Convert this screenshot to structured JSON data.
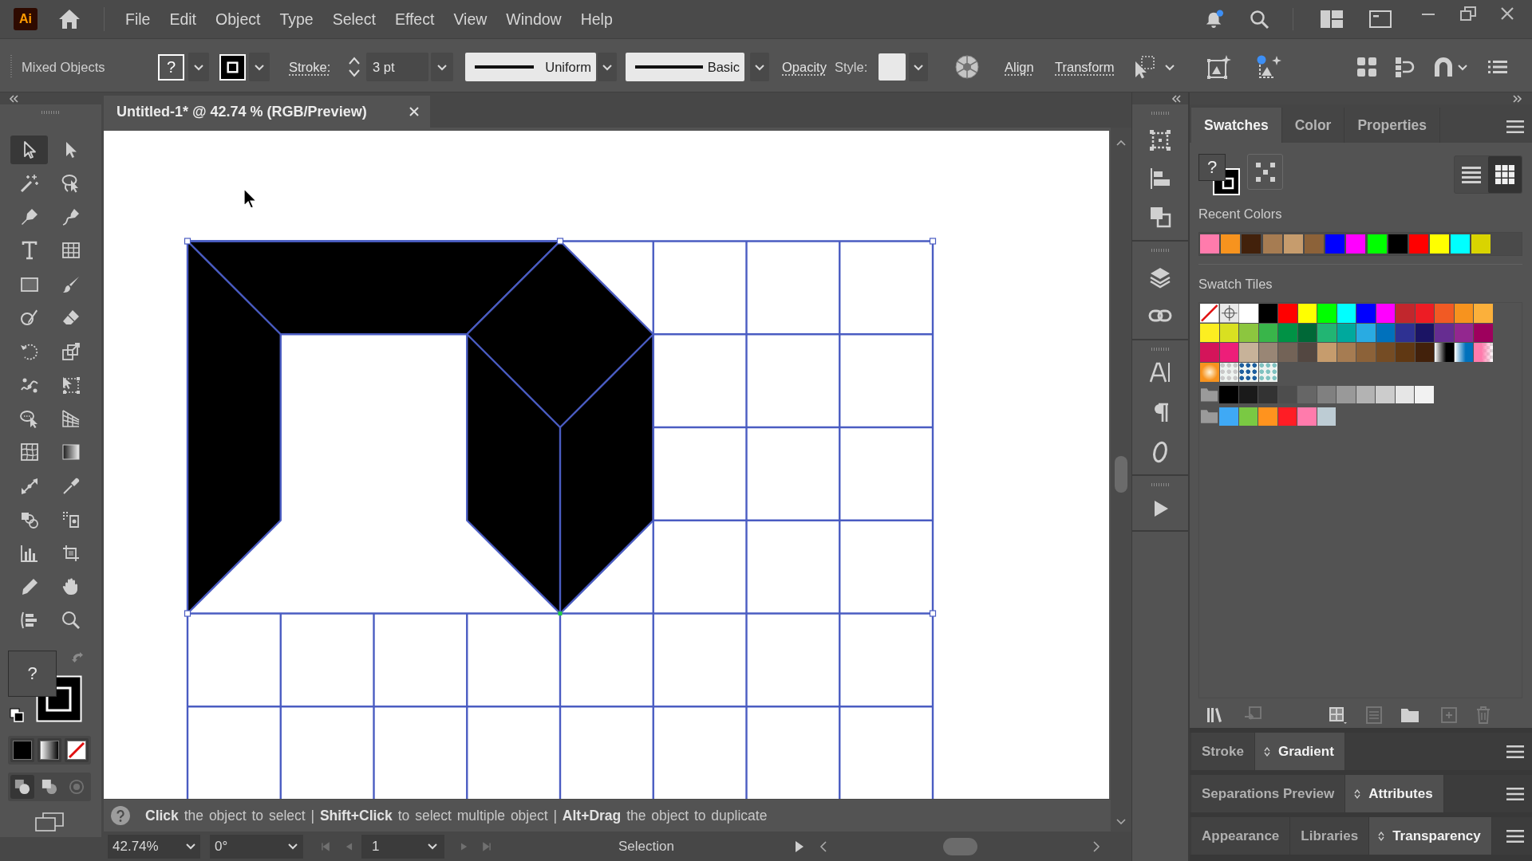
{
  "menu_bar": {
    "logo": "Ai",
    "items": [
      "File",
      "Edit",
      "Object",
      "Type",
      "Select",
      "Effect",
      "View",
      "Window",
      "Help"
    ]
  },
  "control_bar": {
    "selection": "Mixed Objects",
    "fill": "?",
    "stroke_label": "Stroke:",
    "stroke_weight": "3 pt",
    "profile": "Uniform",
    "brush": "Basic",
    "opacity": "Opacity",
    "style_label": "Style:",
    "align": "Align",
    "transform": "Transform"
  },
  "toolbar": {
    "tools": [
      {
        "kind": "selection",
        "selected": true
      },
      {
        "kind": "direct-selection",
        "selected": false
      },
      {
        "kind": "magic-wand",
        "selected": false
      },
      {
        "kind": "lasso",
        "selected": false
      },
      {
        "kind": "pen",
        "selected": false
      },
      {
        "kind": "curvature",
        "selected": false
      },
      {
        "kind": "type",
        "selected": false
      },
      {
        "kind": "grid",
        "selected": false
      },
      {
        "kind": "rectangle",
        "selected": false
      },
      {
        "kind": "paintbrush",
        "selected": false
      },
      {
        "kind": "shaper",
        "selected": false
      },
      {
        "kind": "eraser",
        "selected": false
      },
      {
        "kind": "rotate",
        "selected": false
      },
      {
        "kind": "scale",
        "selected": false
      },
      {
        "kind": "puppet-warp",
        "selected": false
      },
      {
        "kind": "free-transform",
        "selected": false
      },
      {
        "kind": "shape-builder",
        "selected": false
      },
      {
        "kind": "perspective-grid",
        "selected": false
      },
      {
        "kind": "mesh",
        "selected": false
      },
      {
        "kind": "gradient",
        "selected": false
      },
      {
        "kind": "width",
        "selected": false
      },
      {
        "kind": "eyedropper",
        "selected": false
      },
      {
        "kind": "blend",
        "selected": false
      },
      {
        "kind": "live-paint-bucket",
        "selected": false
      },
      {
        "kind": "column-graph",
        "selected": false
      },
      {
        "kind": "artboard",
        "selected": false
      },
      {
        "kind": "pencil",
        "selected": false
      },
      {
        "kind": "hand",
        "selected": false
      },
      {
        "kind": "intertwine",
        "selected": false
      },
      {
        "kind": "zoom",
        "selected": false
      }
    ],
    "fill": "?",
    "color_modes": [
      {
        "kind": "color"
      },
      {
        "kind": "gradient"
      },
      {
        "kind": "none"
      }
    ],
    "draw_modes": [
      {
        "kind": "normal",
        "selected": true,
        "disabled": false
      },
      {
        "kind": "behind",
        "selected": false,
        "disabled": false
      },
      {
        "kind": "inside",
        "selected": false,
        "disabled": true
      }
    ]
  },
  "document": {
    "tab": "Untitled-1* @ 42.74 % (RGB/Preview)",
    "hint": "**Click** the object to select | **Shift+Click** to select multiple object | **Alt+Drag** the object to duplicate"
  },
  "status_bar": {
    "zoom": "42.74%",
    "rotation": "0°",
    "nav": [
      {
        "kind": "first",
        "disabled": true
      },
      {
        "kind": "previous",
        "disabled": true
      },
      {
        "kind": "next",
        "disabled": true
      },
      {
        "kind": "last",
        "disabled": true
      }
    ],
    "artboard": "1",
    "tool": "Selection"
  },
  "panels": {
    "tabs": [
      {
        "label": "Swatches",
        "selected": true
      },
      {
        "label": "Color",
        "selected": false
      },
      {
        "label": "Properties",
        "selected": false
      }
    ],
    "fill": "?",
    "views": [
      {
        "kind": "list",
        "selected": false
      },
      {
        "kind": "grid",
        "selected": true
      }
    ],
    "recent_label": "Recent Colors",
    "recent_colors": [
      {
        "color": "#ff7bac"
      },
      {
        "color": "#f7931e"
      },
      {
        "color": "#42210b"
      },
      {
        "color": "#a67c52"
      },
      {
        "color": "#c69c6d"
      },
      {
        "color": "#8c6239"
      },
      {
        "color": "#0000ff"
      },
      {
        "color": "#ff00ff"
      },
      {
        "color": "#00ff00"
      },
      {
        "color": "#000000"
      },
      {
        "color": "#ff0000"
      },
      {
        "color": "#ffff00"
      },
      {
        "color": "#00ffff"
      },
      {
        "color": "#d9d400"
      }
    ],
    "tiles_label": "Swatch Tiles",
    "swatches": [
      {
        "kind": "none"
      },
      {
        "kind": "registration"
      },
      {
        "kind": "solid",
        "color": "#ffffff"
      },
      {
        "kind": "solid",
        "color": "#000000"
      },
      {
        "kind": "solid",
        "color": "#ff0000"
      },
      {
        "kind": "solid",
        "color": "#ffff00"
      },
      {
        "kind": "solid",
        "color": "#00ff00"
      },
      {
        "kind": "solid",
        "color": "#00ffff"
      },
      {
        "kind": "solid",
        "color": "#0000ff"
      },
      {
        "kind": "solid",
        "color": "#ff00ff"
      },
      {
        "kind": "solid",
        "color": "#c1272d"
      },
      {
        "kind": "solid",
        "color": "#ed1c24"
      },
      {
        "kind": "solid",
        "color": "#f15a24"
      },
      {
        "kind": "solid",
        "color": "#f7931e"
      },
      {
        "kind": "solid",
        "color": "#fbb03b"
      },
      {
        "kind": "solid",
        "color": "#fcee21"
      },
      {
        "kind": "solid",
        "color": "#d9e021"
      },
      {
        "kind": "solid",
        "color": "#8cc63f"
      },
      {
        "kind": "solid",
        "color": "#39b54a"
      },
      {
        "kind": "solid",
        "color": "#009245"
      },
      {
        "kind": "solid",
        "color": "#006837"
      },
      {
        "kind": "solid",
        "color": "#22b573"
      },
      {
        "kind": "solid",
        "color": "#00a99d"
      },
      {
        "kind": "solid",
        "color": "#29abe2"
      },
      {
        "kind": "solid",
        "color": "#0071bc"
      },
      {
        "kind": "solid",
        "color": "#2e3192"
      },
      {
        "kind": "solid",
        "color": "#1b1464"
      },
      {
        "kind": "solid",
        "color": "#662d91"
      },
      {
        "kind": "solid",
        "color": "#93278f"
      },
      {
        "kind": "solid",
        "color": "#9e005d"
      },
      {
        "kind": "solid",
        "color": "#d4145a"
      },
      {
        "kind": "solid",
        "color": "#ed1e79"
      },
      {
        "kind": "solid",
        "color": "#c7b299"
      },
      {
        "kind": "solid",
        "color": "#998675"
      },
      {
        "kind": "solid",
        "color": "#736357"
      },
      {
        "kind": "solid",
        "color": "#534741"
      },
      {
        "kind": "solid",
        "color": "#c69c6d"
      },
      {
        "kind": "solid",
        "color": "#a67c52"
      },
      {
        "kind": "solid",
        "color": "#8c6239"
      },
      {
        "kind": "solid",
        "color": "#754c24"
      },
      {
        "kind": "solid",
        "color": "#603813"
      },
      {
        "kind": "solid",
        "color": "#42210b"
      },
      {
        "kind": "gradient",
        "color": "#000000"
      },
      {
        "kind": "gradient",
        "color": "#0071bc"
      },
      {
        "kind": "fade",
        "color": "#ff7bac"
      },
      {
        "kind": "radial",
        "color": "#f7931e"
      },
      {
        "kind": "pattern",
        "color": "#c9c9c9"
      },
      {
        "kind": "pattern",
        "color": "#1d5f9e"
      },
      {
        "kind": "pattern",
        "color": "#7fc2c0"
      }
    ],
    "color_groups": [
      {
        "swatches": [
          {
            "color": "#000000"
          },
          {
            "color": "#1a1a1a"
          },
          {
            "color": "#333333"
          },
          {
            "color": "#4d4d4d"
          },
          {
            "color": "#666666"
          },
          {
            "color": "#808080"
          },
          {
            "color": "#999999"
          },
          {
            "color": "#b3b3b3"
          },
          {
            "color": "#cccccc"
          },
          {
            "color": "#e6e6e6"
          },
          {
            "color": "#f2f2f2"
          }
        ]
      },
      {
        "swatches": [
          {
            "color": "#3fa9f5"
          },
          {
            "color": "#7ac943"
          },
          {
            "color": "#ff931e"
          },
          {
            "color": "#ff1d25"
          },
          {
            "color": "#ff7bac"
          },
          {
            "color": "#bdccd4"
          }
        ]
      }
    ],
    "actions": [
      {
        "kind": "libraries",
        "disabled": false
      },
      {
        "kind": "place",
        "disabled": true
      },
      {
        "kind": "kinds",
        "disabled": false
      },
      {
        "kind": "options",
        "disabled": true
      },
      {
        "kind": "new-group",
        "disabled": false
      },
      {
        "kind": "new-swatch",
        "disabled": true
      },
      {
        "kind": "delete",
        "disabled": true
      }
    ]
  },
  "panel_groups": [
    {
      "tabs": [
        {
          "label": "Stroke",
          "selected": false
        },
        {
          "label": "Gradient",
          "selected": true
        }
      ]
    },
    {
      "tabs": [
        {
          "label": "Separations Preview",
          "selected": false
        },
        {
          "label": "Attributes",
          "selected": true
        }
      ]
    },
    {
      "tabs": [
        {
          "label": "Appearance",
          "selected": false
        },
        {
          "label": "Libraries",
          "selected": false
        },
        {
          "label": "Transparency",
          "selected": true
        }
      ]
    }
  ]
}
